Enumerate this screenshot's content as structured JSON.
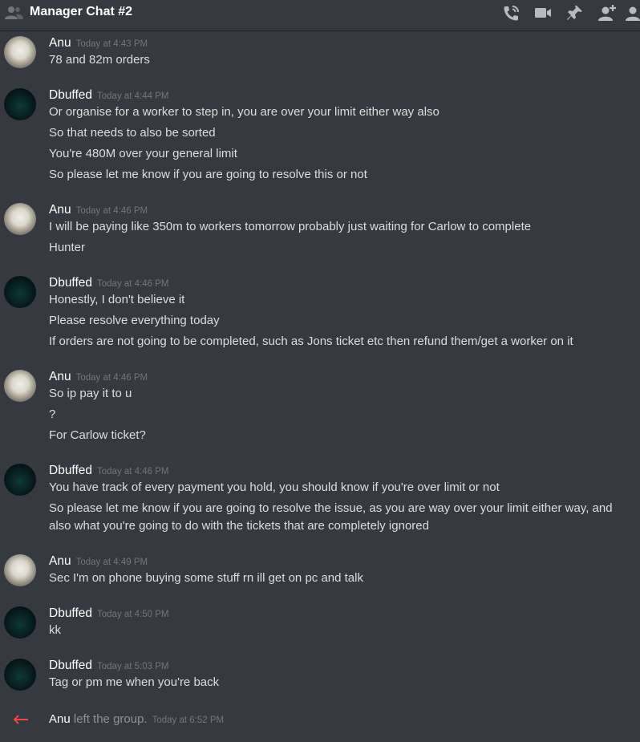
{
  "header": {
    "title": "Manager Chat #2",
    "icons": [
      "people-icon",
      "phone-call-icon",
      "video-call-icon",
      "pin-icon",
      "add-member-icon",
      "member-list-icon"
    ]
  },
  "messages": [
    {
      "author": "Anu",
      "timestamp": "Today at 4:43 PM",
      "lines": [
        "78 and 82m orders"
      ]
    },
    {
      "author": "Dbuffed",
      "timestamp": "Today at 4:44 PM",
      "lines": [
        "Or organise for a worker to step in, you are over your limit either way also",
        "So that needs to also be sorted",
        "You're 480M over your general limit",
        "So please let me know if you are going to resolve this or not"
      ]
    },
    {
      "author": "Anu",
      "timestamp": "Today at 4:46 PM",
      "lines": [
        "I will be paying like 350m to workers tomorrow probably just waiting for Carlow to complete",
        "Hunter"
      ]
    },
    {
      "author": "Dbuffed",
      "timestamp": "Today at 4:46 PM",
      "lines": [
        "Honestly, I don't believe it",
        "Please resolve everything today",
        "If orders are not going to be completed, such as Jons ticket etc then refund them/get a worker on it"
      ]
    },
    {
      "author": "Anu",
      "timestamp": "Today at 4:46 PM",
      "lines": [
        "So ip pay it to u",
        "?",
        "For Carlow ticket?"
      ]
    },
    {
      "author": "Dbuffed",
      "timestamp": "Today at 4:46 PM",
      "lines": [
        "You have track of every payment you hold, you should know if you're over limit or not",
        "So please let me know if you are going to resolve the issue, as you are way over your limit either way, and also what you're going to do with the tickets that are completely ignored"
      ]
    },
    {
      "author": "Anu",
      "timestamp": "Today at 4:49 PM",
      "lines": [
        "Sec I'm on phone buying some stuff rn ill get on pc and talk"
      ]
    },
    {
      "author": "Dbuffed",
      "timestamp": "Today at 4:50 PM",
      "lines": [
        "kk"
      ]
    },
    {
      "author": "Dbuffed",
      "timestamp": "Today at 5:03 PM",
      "lines": [
        "Tag or pm me when you're back"
      ]
    }
  ],
  "system": {
    "name": "Anu",
    "text": " left the group.",
    "timestamp": "Today at 6:52 PM"
  },
  "colors": {
    "background": "#36393f",
    "text": "#dcddde",
    "timestamp": "#72767d",
    "leave_arrow": "#f04747"
  }
}
